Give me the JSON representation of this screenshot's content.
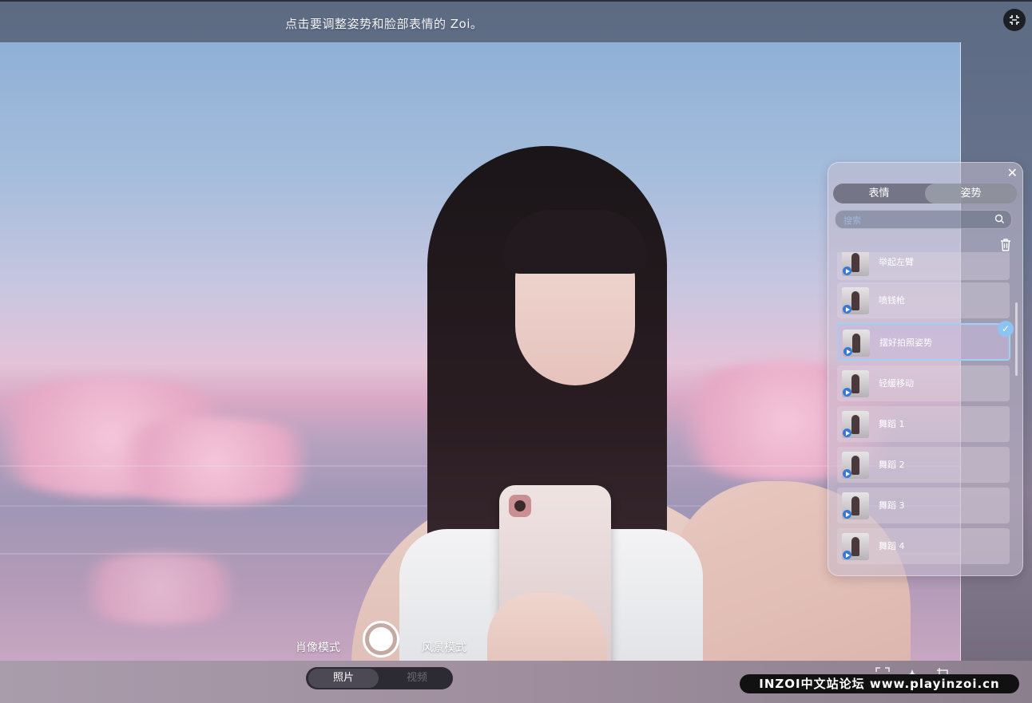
{
  "header": {
    "hint": "点击要调整姿势和脸部表情的 Zoi。"
  },
  "capture": {
    "left_mode": "肖像模式",
    "right_mode": "风景模式",
    "media_toggle": [
      "照片",
      "视频"
    ],
    "active_media": "照片"
  },
  "panel": {
    "tabs": [
      "表情",
      "姿势"
    ],
    "active_tab": "姿势",
    "search_placeholder": "搜索",
    "items": [
      {
        "label": "举起左臂",
        "selected": false
      },
      {
        "label": "喷钱枪",
        "selected": false
      },
      {
        "label": "摆好拍照姿势",
        "selected": true
      },
      {
        "label": "轻缓移动",
        "selected": false
      },
      {
        "label": "舞蹈 1",
        "selected": false
      },
      {
        "label": "舞蹈 2",
        "selected": false
      },
      {
        "label": "舞蹈 3",
        "selected": false
      },
      {
        "label": "舞蹈 4",
        "selected": false
      }
    ]
  },
  "watermark": "INZOI中文站论坛 www.playinzoi.cn",
  "colors": {
    "selection_border": "#9fd0f6",
    "play_badge": "#3779d4",
    "toggle_bg": "#2c2a33"
  },
  "icons": [
    "shrink-icon",
    "close-icon",
    "search-icon",
    "trash-icon",
    "play-icon",
    "check-icon",
    "fullscreen-icon",
    "sparkle-icon",
    "crop-icon"
  ]
}
